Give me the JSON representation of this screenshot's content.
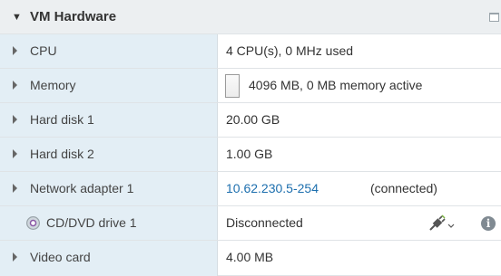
{
  "panel": {
    "title": "VM Hardware"
  },
  "rows": [
    {
      "label": "CPU",
      "value": "4 CPU(s), 0 MHz used"
    },
    {
      "label": "Memory",
      "value": "4096 MB, 0 MB memory active",
      "usage_fraction": 0
    },
    {
      "label": "Hard disk 1",
      "value": "20.00 GB"
    },
    {
      "label": "Hard disk 2",
      "value": "1.00 GB"
    },
    {
      "label": "Network adapter 1",
      "link": "10.62.230.5-254",
      "status": "(connected)"
    },
    {
      "label": "CD/DVD drive 1",
      "value": "Disconnected"
    },
    {
      "label": "Video card",
      "value": "4.00 MB"
    }
  ],
  "icons": {
    "header_caret": "caret-down-icon",
    "maximize": "maximize-icon",
    "cd": "cd-dvd-icon",
    "connect": "connect-plug-icon",
    "info": "info-icon"
  },
  "colors": {
    "label_bg": "#e3eef5",
    "link": "#1d6fae",
    "header_bg": "#eceff1"
  }
}
